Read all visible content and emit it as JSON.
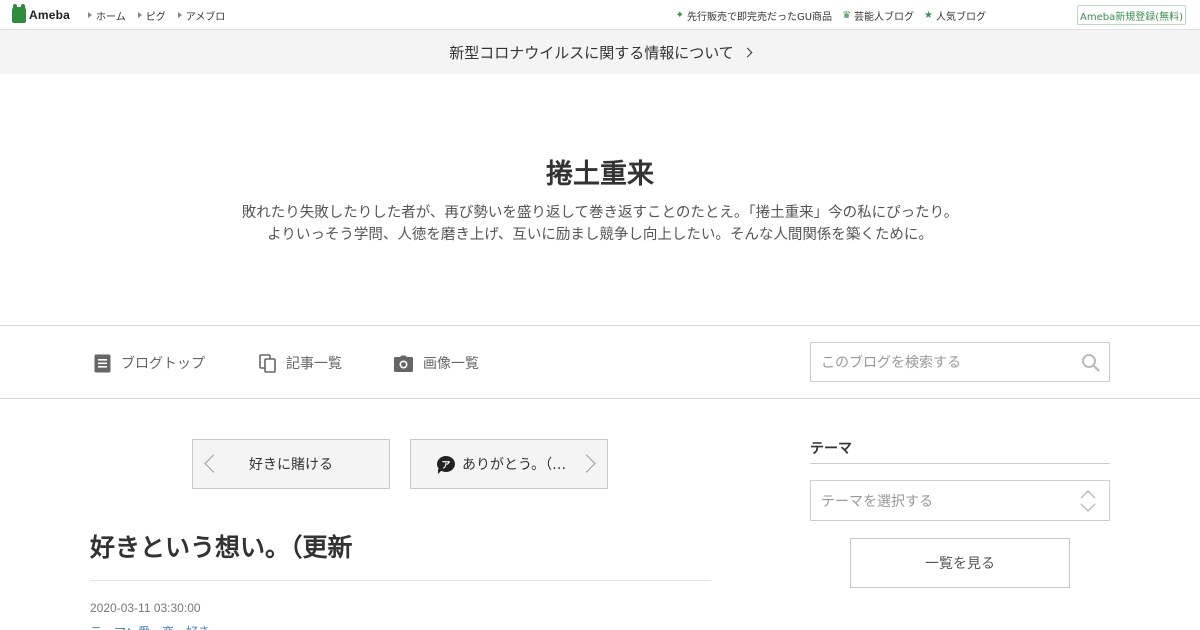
{
  "header": {
    "logo": "Ameba",
    "nav": [
      "ホーム",
      "ピグ",
      "アメブロ"
    ],
    "links": [
      {
        "icon": "sparkle-icon",
        "label": "先行販売で即完売だったGU商品"
      },
      {
        "icon": "crown-icon",
        "label": "芸能人ブログ"
      },
      {
        "icon": "star-icon",
        "label": "人気ブログ"
      }
    ],
    "register": "Ameba新規登録(無料)"
  },
  "notice": "新型コロナウイルスに関する情報について",
  "blog": {
    "title": "捲土重来",
    "description_line1": "敗れたり失敗したりした者が、再び勢いを盛り返して巻き返すことのたとえ。「捲土重来」今の私にぴったり。",
    "description_line2": "よりいっそう学問、人徳を磨き上げ、互いに励まし競争し向上したい。そんな人間関係を築くために。"
  },
  "nav": {
    "top": "ブログトップ",
    "articles": "記事一覧",
    "images": "画像一覧",
    "search_placeholder": "このブログを検索する"
  },
  "pager": {
    "prev": "好きに賭ける",
    "next": "ありがとう。（…"
  },
  "article": {
    "title": "好きという想い。（更新",
    "date": "2020-03-11 03:30:00",
    "theme": "テーマ：愛・恋・好き"
  },
  "sidebar": {
    "heading": "テーマ",
    "select_placeholder": "テーマを選択する",
    "list_button": "一覧を見る"
  },
  "colors": {
    "brand_green": "#2d8c3c",
    "link_blue": "#3a7dbf",
    "notice_bg": "#f4f4f4"
  }
}
